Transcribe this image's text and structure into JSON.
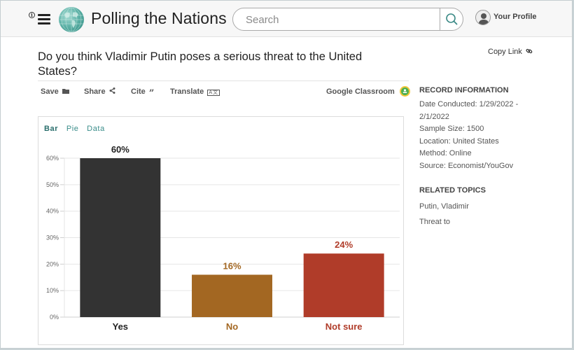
{
  "header": {
    "brand": "Polling the Nations",
    "search_placeholder": "Search",
    "search_value": "",
    "profile_label": "Your Profile",
    "icons": [
      "info-icon",
      "hamburger-menu-icon",
      "globe-logo-icon",
      "search-icon",
      "user-avatar-icon"
    ]
  },
  "question": "Do you think Vladimir Putin poses a serious threat to the United States?",
  "copy_link": {
    "label": "Copy Link",
    "icon": "link-icon"
  },
  "actions": {
    "save": {
      "label": "Save",
      "icon": "folder-icon"
    },
    "share": {
      "label": "Share",
      "icon": "share-icon"
    },
    "cite": {
      "label": "Cite",
      "icon": "quote-icon"
    },
    "translate": {
      "label": "Translate",
      "icon": "translate-icon",
      "glyph": "A文"
    },
    "google_classroom": {
      "label": "Google Classroom",
      "icon": "google-classroom-icon"
    }
  },
  "chart_tabs": [
    {
      "label": "Bar",
      "active": true
    },
    {
      "label": "Pie",
      "active": false
    },
    {
      "label": "Data",
      "active": false
    }
  ],
  "chart_data": {
    "type": "bar",
    "title": "",
    "xlabel": "",
    "ylabel": "",
    "categories": [
      "Yes",
      "No",
      "Not sure"
    ],
    "values": [
      60,
      16,
      24
    ],
    "data_labels": [
      "60%",
      "16%",
      "24%"
    ],
    "colors": [
      "#333333",
      "#a36722",
      "#b03c29"
    ],
    "ylim": [
      0,
      60
    ],
    "yticks": [
      0,
      10,
      20,
      30,
      40,
      50,
      60
    ],
    "ytick_labels": [
      "0%",
      "10%",
      "20%",
      "30%",
      "40%",
      "50%",
      "60%"
    ],
    "grid": true,
    "legend": "none"
  },
  "sidebar": {
    "record_heading": "RECORD INFORMATION",
    "record_lines": [
      "Date Conducted: 1/29/2022 -",
      "2/1/2022",
      "Sample Size: 1500",
      "Location: United States",
      "Method: Online",
      "Source: Economist/YouGov"
    ],
    "topics_heading": "RELATED TOPICS",
    "topics": [
      "Putin, Vladimir",
      "Threat to"
    ]
  }
}
